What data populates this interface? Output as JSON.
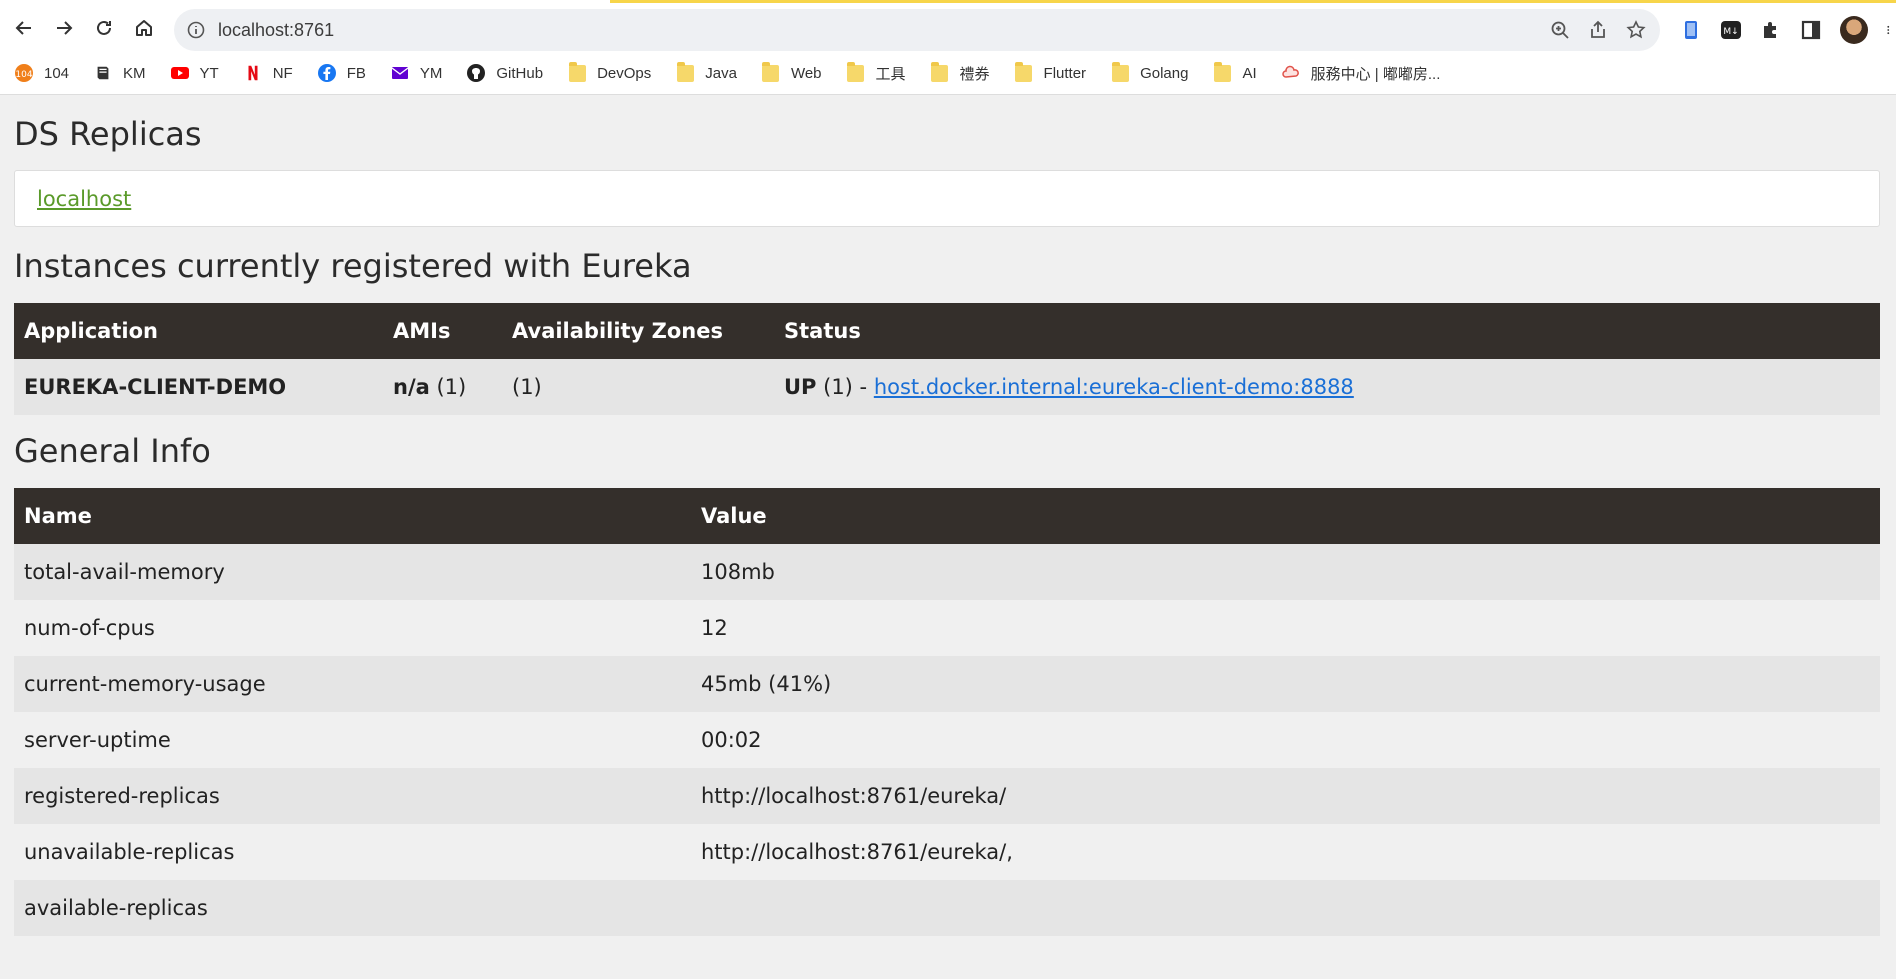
{
  "browser": {
    "url": "localhost:8761",
    "bookmarks": [
      {
        "label": "104",
        "icon": "104-icon"
      },
      {
        "label": "KM",
        "icon": "book-icon"
      },
      {
        "label": "YT",
        "icon": "youtube-icon"
      },
      {
        "label": "NF",
        "icon": "netflix-icon"
      },
      {
        "label": "FB",
        "icon": "facebook-icon"
      },
      {
        "label": "YM",
        "icon": "mail-icon"
      },
      {
        "label": "GitHub",
        "icon": "github-icon"
      },
      {
        "label": "DevOps",
        "icon": "folder-icon"
      },
      {
        "label": "Java",
        "icon": "folder-icon"
      },
      {
        "label": "Web",
        "icon": "folder-icon"
      },
      {
        "label": "工具",
        "icon": "folder-icon"
      },
      {
        "label": "禮券",
        "icon": "folder-icon"
      },
      {
        "label": "Flutter",
        "icon": "folder-icon"
      },
      {
        "label": "Golang",
        "icon": "folder-icon"
      },
      {
        "label": "AI",
        "icon": "folder-icon"
      },
      {
        "label": "服務中心 | 嘟嘟房...",
        "icon": "cloud-icon"
      }
    ]
  },
  "ds_replicas": {
    "title": "DS Replicas",
    "link": "localhost"
  },
  "instances": {
    "title": "Instances currently registered with Eureka",
    "headers": [
      "Application",
      "AMIs",
      "Availability Zones",
      "Status"
    ],
    "row": {
      "application": "EUREKA-CLIENT-DEMO",
      "amis_bold": "n/a",
      "amis_count": " (1)",
      "zones": "(1)",
      "status_bold": "UP",
      "status_count": " (1) - ",
      "status_link": "host.docker.internal:eureka-client-demo:8888"
    }
  },
  "general_info": {
    "title": "General Info",
    "headers": [
      "Name",
      "Value"
    ],
    "rows": [
      {
        "name": "total-avail-memory",
        "value": "108mb"
      },
      {
        "name": "num-of-cpus",
        "value": "12"
      },
      {
        "name": "current-memory-usage",
        "value": "45mb (41%)"
      },
      {
        "name": "server-uptime",
        "value": "00:02"
      },
      {
        "name": "registered-replicas",
        "value": "http://localhost:8761/eureka/"
      },
      {
        "name": "unavailable-replicas",
        "value": "http://localhost:8761/eureka/,"
      },
      {
        "name": "available-replicas",
        "value": ""
      }
    ]
  }
}
